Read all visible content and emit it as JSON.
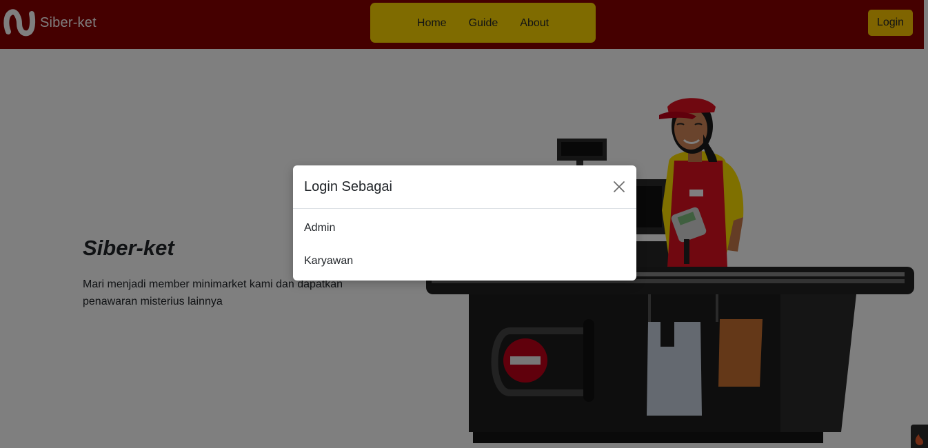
{
  "navbar": {
    "brand_text": "Siber-ket",
    "links": [
      "Home",
      "Guide",
      "About"
    ],
    "login_label": "Login"
  },
  "hero": {
    "title": "Siber-ket",
    "text": "Mari menjadi member minimarket kami dan dapatkan penawaran misterius lainnya"
  },
  "modal": {
    "title": "Login Sebagai",
    "options": [
      "Admin",
      "Karyawan"
    ]
  },
  "icons": {
    "brand": "logo-s-icon",
    "close": "close-icon",
    "corner": "flame-icon"
  },
  "colors": {
    "navbar": "#8b0000",
    "nav_pill": "#ffd700",
    "login_button": "#ffc800",
    "backdrop_opacity": 0.5
  }
}
